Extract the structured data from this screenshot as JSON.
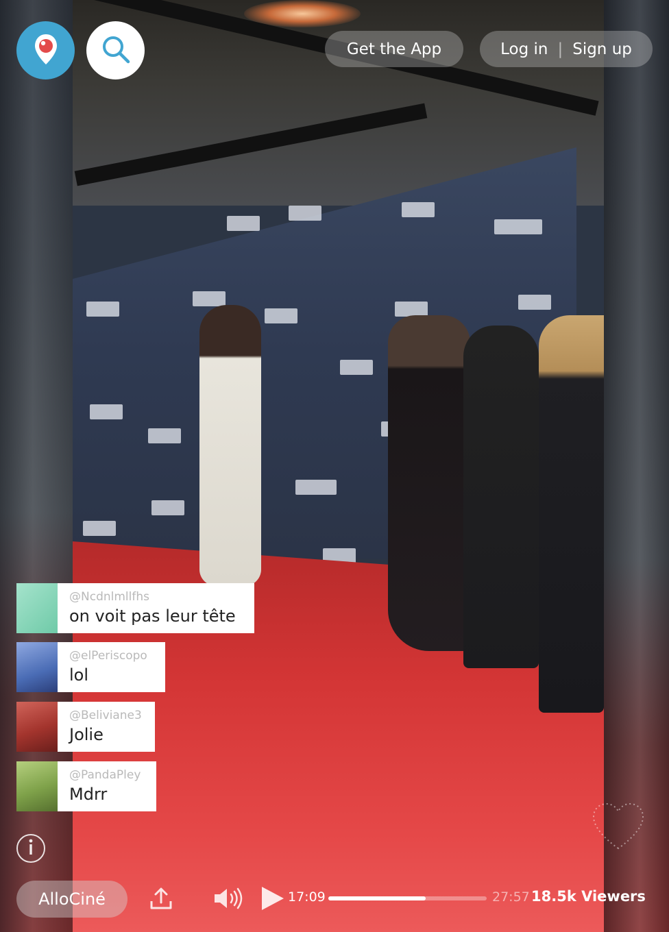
{
  "header": {
    "get_app_label": "Get the App",
    "login_label": "Log in",
    "separator": "|",
    "signup_label": "Sign up"
  },
  "comments": [
    {
      "user": "@Ncdnlmllfhs",
      "message": "on voit pas leur tête",
      "avatar_color": "#8fd8bd"
    },
    {
      "user": "@elPeriscopo",
      "message": "lol",
      "avatar_color": "#5b7fc6"
    },
    {
      "user": "@Beliviane3",
      "message": "Jolie",
      "avatar_color": "#b8483e"
    },
    {
      "user": "@PandaPley",
      "message": "Mdrr",
      "avatar_color": "#8cae56"
    }
  ],
  "player": {
    "broadcaster": "AlloCiné",
    "current_time": "17:09",
    "total_time": "27:57",
    "progress": 0.614,
    "viewers": "18.5k Viewers"
  },
  "colors": {
    "brand_blue": "#41a5d1",
    "brand_red": "#e34b4b"
  },
  "icons": {
    "logo": "periscope-logo-icon",
    "search": "search-icon",
    "info": "info-icon",
    "share": "share-icon",
    "volume": "volume-icon",
    "play": "play-icon",
    "heart": "heart-icon"
  }
}
